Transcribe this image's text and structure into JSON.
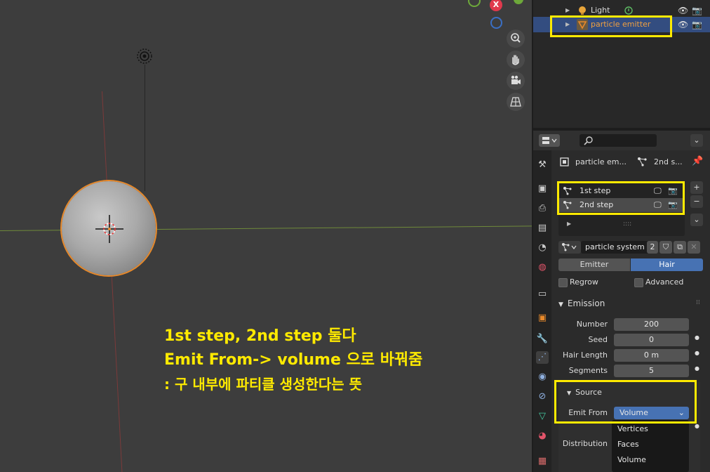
{
  "viewport": {
    "gizmo_x_label": "X",
    "annotation": {
      "line1": "1st step, 2nd step 둘다",
      "line2": "Emit From-> volume 으로 바꿔줌",
      "line3": ": 구 내부에 파티클 생성한다는 뜻"
    }
  },
  "outliner": {
    "rows": [
      {
        "label": "Light"
      },
      {
        "label": "particle emitter"
      }
    ]
  },
  "properties": {
    "breadcrumb_object": "particle em...",
    "breadcrumb_system": "2nd s...",
    "particle_slots": [
      "1st step",
      "2nd step"
    ],
    "list_handle": "::::",
    "settings_name": "particle system",
    "users_count": "2",
    "type_emitter": "Emitter",
    "type_hair": "Hair",
    "regrow_label": "Regrow",
    "advanced_label": "Advanced",
    "emission": {
      "header": "Emission",
      "number_label": "Number",
      "number_value": "200",
      "seed_label": "Seed",
      "seed_value": "0",
      "hair_length_label": "Hair Length",
      "hair_length_value": "0 m",
      "segments_label": "Segments",
      "segments_value": "5"
    },
    "source": {
      "header": "Source",
      "emit_from_label": "Emit From",
      "emit_from_value": "Volume",
      "distribution_label": "Distribution",
      "options": [
        "Vertices",
        "Faces",
        "Volume"
      ]
    }
  },
  "colors": {
    "highlight": "#ffea00",
    "selection": "#334d80",
    "accent": "#4772b3",
    "object_outline": "#e8892a"
  }
}
